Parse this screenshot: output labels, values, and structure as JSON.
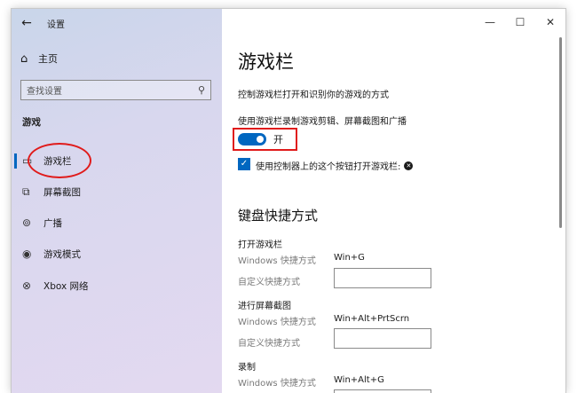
{
  "app": {
    "title": "设置"
  },
  "icons": {
    "back": "back-arrow-icon",
    "home": "home-icon",
    "search": "search-icon",
    "game_bar": "game-bar-icon",
    "captures": "captures-icon",
    "broadcasting": "broadcast-icon",
    "game_mode": "game-mode-icon",
    "xbox": "xbox-icon"
  },
  "sidebar": {
    "home_label": "主页",
    "search_placeholder": "查找设置",
    "section": "游戏",
    "items": [
      {
        "label": "游戏栏",
        "active": true
      },
      {
        "label": "屏幕截图"
      },
      {
        "label": "广播"
      },
      {
        "label": "游戏模式"
      },
      {
        "label": "Xbox 网络"
      }
    ]
  },
  "window_controls": {
    "minimize": "—",
    "maximize": "☐",
    "close": "✕"
  },
  "main": {
    "title": "游戏栏",
    "description": "控制游戏栏打开和识别你的游戏的方式",
    "toggle_label": "使用游戏栏录制游戏剪辑、屏幕截图和广播",
    "toggle_state": "开",
    "toggle_on": true,
    "checkbox_label": "使用控制器上的这个按钮打开游戏栏:",
    "checkbox_checked": true,
    "shortcuts_heading": "键盘快捷方式",
    "shortcut_groups": [
      {
        "title": "打开游戏栏",
        "windows_label": "Windows 快捷方式",
        "windows_value": "Win+G",
        "custom_label": "自定义快捷方式",
        "custom_value": ""
      },
      {
        "title": "进行屏幕截图",
        "windows_label": "Windows 快捷方式",
        "windows_value": "Win+Alt+PrtScrn",
        "custom_label": "自定义快捷方式",
        "custom_value": ""
      },
      {
        "title": "录制",
        "windows_label": "Windows 快捷方式",
        "windows_value": "Win+Alt+G"
      }
    ]
  },
  "colors": {
    "accent": "#0067c0",
    "highlight": "#e01b1b"
  }
}
